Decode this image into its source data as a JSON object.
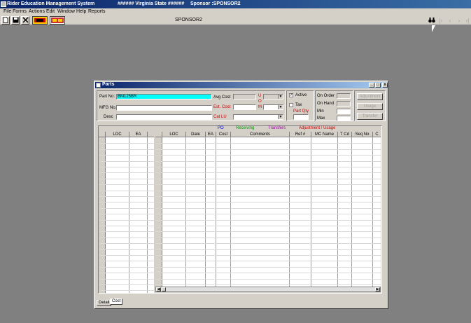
{
  "app": {
    "title": "Rider Education Management System",
    "state": "###### Virginia State ######",
    "sponsor": "Sponsor :SPONSOR2"
  },
  "menu": [
    "File",
    "Forms",
    "Actions",
    "Edit",
    "Window",
    "Help",
    "Reports"
  ],
  "toolbar": {
    "caption": "SPONSOR2",
    "icons": [
      "new-icon",
      "save-icon",
      "close-icon",
      "report-icon",
      "report2-icon",
      "binoculars-icon",
      "first-record-icon",
      "prev-record-icon",
      "next-record-icon",
      "last-record-icon"
    ]
  },
  "window": {
    "title": "Parts",
    "min": "_",
    "max": "□",
    "close": "x"
  },
  "form": {
    "part_no_label": "Part No:",
    "part_no_value": "BM125BR",
    "mfg_no_label": "MFG No.",
    "desc_label": "Desc",
    "avg_cost_label": "Avg Cost",
    "est_cost_label": "Est. Cost",
    "cat_lu_label": "Cat LU",
    "uom_u": "U",
    "uom_o": "O",
    "uom_m": "M",
    "active_label": "Active",
    "active_checked": "✓",
    "tax_label": "Tax",
    "part_qty_label": "Part Qty",
    "on_order_label": "On Order",
    "on_hand_label": "On Hand",
    "min_label": "Min",
    "max_label": "Max",
    "btn_adjustment": "Adjustment",
    "btn_usage": "Usage",
    "btn_transfer": "Transfer"
  },
  "categories": {
    "po": "PO",
    "receiving": "Receiving",
    "transfers": "Transfers",
    "adjustment": "Adjustment / Usage",
    "colors": {
      "po": "#0000cc",
      "receiving": "#009900",
      "transfers": "#990099",
      "adjustment": "#cc0000"
    }
  },
  "left_grid": {
    "columns": [
      "LOC",
      "EA"
    ]
  },
  "right_grid": {
    "columns": [
      "LOC",
      "Date",
      "EA",
      "Cost",
      "Comments",
      "Ref #",
      "MC Name",
      "T Cd",
      "Seq No",
      "C"
    ]
  },
  "tabs": [
    "Detail",
    "Cost"
  ]
}
